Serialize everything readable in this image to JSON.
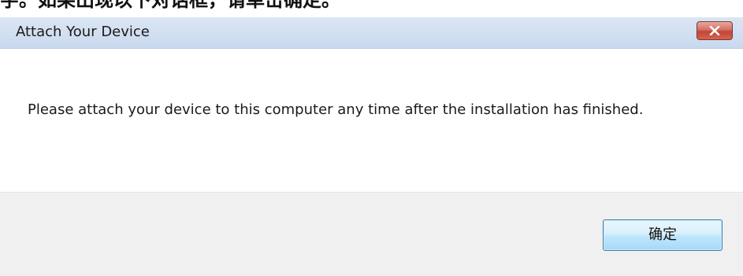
{
  "background_text": "字。如果出现以下对话框，请单击确定。",
  "dialog": {
    "title": "Attach Your Device",
    "message": "Please attach your device to this computer any time after the installation has finished.",
    "ok_label": "确定"
  },
  "icons": {
    "close": "close-icon"
  },
  "colors": {
    "titlebar": "#c9d9ee",
    "footer": "#f0f0f0",
    "close_button": "#c0463a",
    "ok_button": "#bee6fd"
  }
}
